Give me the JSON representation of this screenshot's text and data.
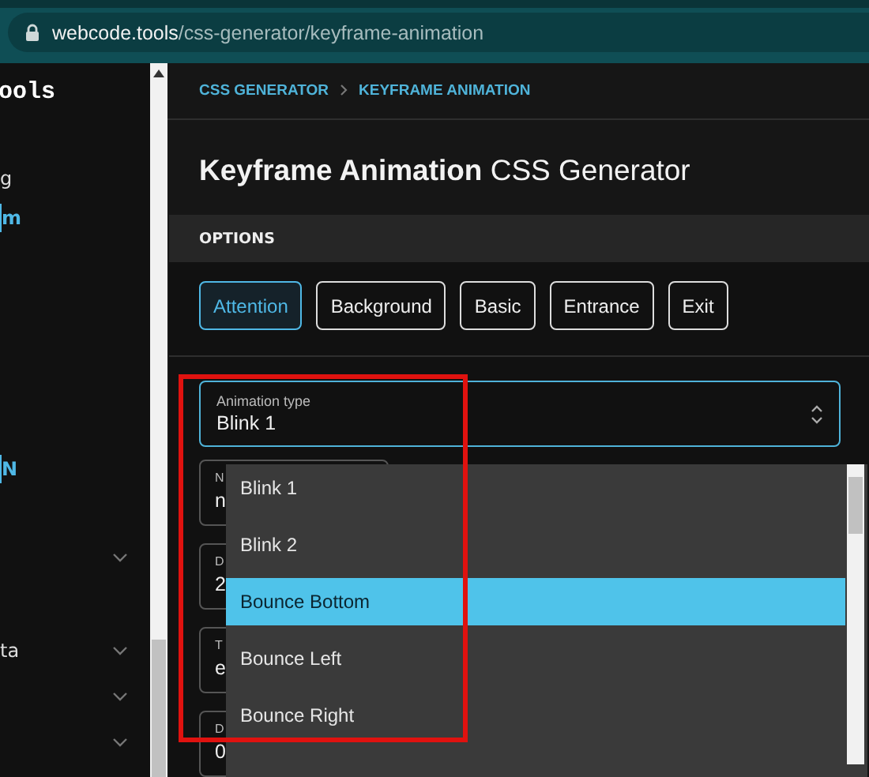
{
  "browser": {
    "url_host": "webcode.tools",
    "url_path": "/css-generator/keyframe-animation"
  },
  "sidebar": {
    "logo": "ools",
    "items": [
      {
        "label": "g",
        "selected": false,
        "expandable": false
      },
      {
        "label": "m",
        "selected": true,
        "expandable": false
      },
      {
        "label": "N",
        "selected": true,
        "expandable": false
      },
      {
        "selected": false,
        "expandable": true
      },
      {
        "label": "ta",
        "selected": false,
        "expandable": true
      },
      {
        "selected": false,
        "expandable": true
      },
      {
        "selected": false,
        "expandable": true
      }
    ]
  },
  "breadcrumb": [
    "CSS GENERATOR",
    "KEYFRAME ANIMATION"
  ],
  "title": "**Keyframe Animation** CSS Generator",
  "options": {
    "header": "OPTIONS",
    "tabs": [
      {
        "label": "Attention",
        "selected": true
      },
      {
        "label": "Background",
        "selected": false
      },
      {
        "label": "Basic",
        "selected": false
      },
      {
        "label": "Entrance",
        "selected": false
      },
      {
        "label": "Exit",
        "selected": false
      }
    ],
    "select": {
      "label": "Animation type",
      "value": "Blink 1"
    },
    "fields": [
      {
        "label": "N",
        "value": "n"
      },
      {
        "label": "D",
        "value": "2"
      },
      {
        "label": "T",
        "value": "e"
      },
      {
        "label": "D",
        "value": "0"
      }
    ],
    "dropdown": [
      {
        "label": "Blink 1",
        "selected": false
      },
      {
        "label": "Blink 2",
        "selected": false
      },
      {
        "label": "Bounce Bottom",
        "selected": true
      },
      {
        "label": "Bounce Left",
        "selected": false
      },
      {
        "label": "Bounce Right",
        "selected": false
      }
    ]
  }
}
